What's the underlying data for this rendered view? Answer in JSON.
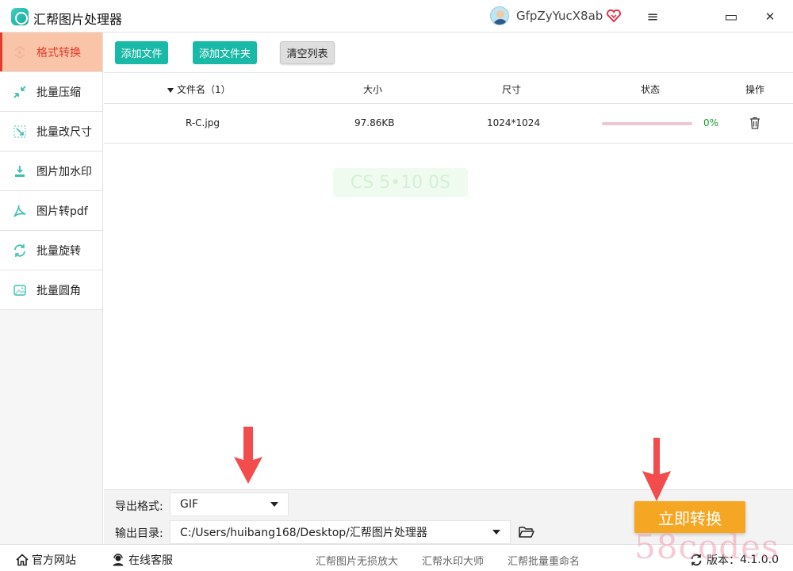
{
  "window": {
    "title": "汇帮图片处理器",
    "username": "GfpZyYucX8ab",
    "controls": {
      "menu": "≡",
      "maximize": "▭",
      "close": "✕"
    }
  },
  "sidebar": {
    "items": [
      {
        "label": "格式转换",
        "icon": "format-convert-icon",
        "active": true
      },
      {
        "label": "批量压缩",
        "icon": "compress-icon",
        "active": false
      },
      {
        "label": "批量改尺寸",
        "icon": "resize-icon",
        "active": false
      },
      {
        "label": "图片加水印",
        "icon": "watermark-icon",
        "active": false
      },
      {
        "label": "图片转pdf",
        "icon": "pdf-icon",
        "active": false
      },
      {
        "label": "批量旋转",
        "icon": "rotate-icon",
        "active": false
      },
      {
        "label": "批量圆角",
        "icon": "rounded-corner-icon",
        "active": false
      }
    ]
  },
  "toolbar": {
    "add_file": "添加文件",
    "add_folder": "添加文件夹",
    "clear_list": "清空列表"
  },
  "table": {
    "columns": {
      "name": "文件名（1）",
      "size": "大小",
      "dimensions": "尺寸",
      "status": "状态",
      "action": "操作"
    },
    "rows": [
      {
        "name": "R-C.jpg",
        "size": "97.86KB",
        "dimensions": "1024*1024",
        "progress": 0,
        "progress_text": "0%"
      }
    ]
  },
  "output": {
    "format_label": "导出格式:",
    "format_value": "GIF",
    "dir_label": "输出目录:",
    "dir_value": "C:/Users/huibang168/Desktop/汇帮图片处理器",
    "convert_button": "立即转换"
  },
  "footer": {
    "website": "官方网站",
    "support": "在线客服",
    "links": [
      "汇帮图片无损放大",
      "汇帮水印大师",
      "汇帮批量重命名"
    ],
    "version_label": "版本：",
    "version_value": "4.1.0.0"
  },
  "overlay": {
    "watermark": "58codes",
    "faint_watermark": "CS 5•10 0S"
  },
  "colors": {
    "accent_teal": "#19b9a8",
    "active_bg": "#f9c4a8",
    "active_text": "#e33c2a",
    "convert_orange": "#f5a623",
    "progress_ok": "#1a9e2c",
    "annotation_red": "#f24c4c"
  }
}
